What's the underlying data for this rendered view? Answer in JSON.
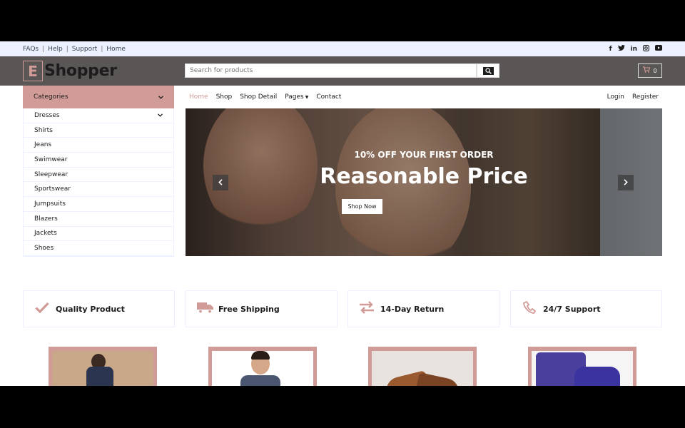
{
  "topbar": {
    "links": [
      "FAQs",
      "Help",
      "Support",
      "Home"
    ],
    "socials": [
      "facebook-icon",
      "twitter-icon",
      "linkedin-icon",
      "instagram-icon",
      "youtube-icon"
    ]
  },
  "header": {
    "logo_letter": "E",
    "logo_text": "Shopper",
    "search_placeholder": "Search for products",
    "cart_count": "0"
  },
  "categories": {
    "title": "Categories",
    "items": [
      "Dresses",
      "Shirts",
      "Jeans",
      "Swimwear",
      "Sleepwear",
      "Sportswear",
      "Jumpsuits",
      "Blazers",
      "Jackets",
      "Shoes"
    ]
  },
  "nav": {
    "home": "Home",
    "shop": "Shop",
    "shop_detail": "Shop Detail",
    "pages": "Pages",
    "contact": "Contact",
    "login": "Login",
    "register": "Register"
  },
  "hero": {
    "subtitle": "10% OFF YOUR FIRST ORDER",
    "title": "Reasonable Price",
    "button": "Shop Now"
  },
  "features": [
    {
      "icon": "check-icon",
      "label": "Quality Product"
    },
    {
      "icon": "truck-icon",
      "label": "Free Shipping"
    },
    {
      "icon": "exchange-icon",
      "label": "14-Day Return"
    },
    {
      "icon": "phone-icon",
      "label": "24/7 Support"
    }
  ],
  "colors": {
    "accent": "#d19c97",
    "header_bg": "#5b5656",
    "topbar_bg": "#edf1ff"
  }
}
